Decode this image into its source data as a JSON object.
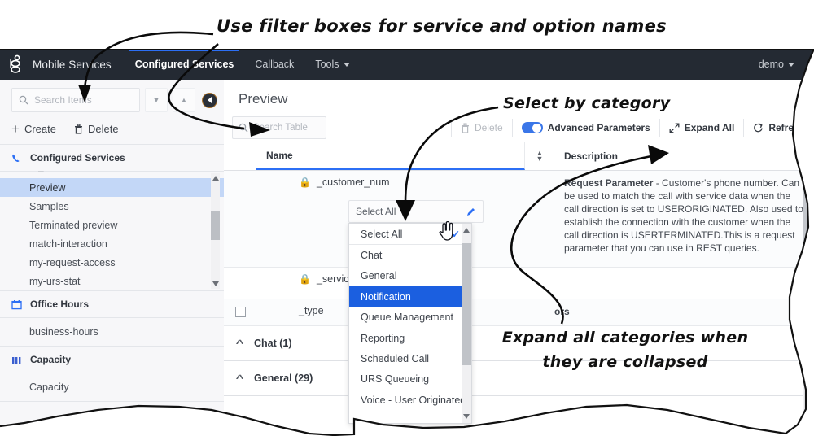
{
  "topnav": {
    "logo": "genesys-logo-icon",
    "brand": "Mobile Services",
    "items": [
      {
        "label": "Configured Services",
        "active": true
      },
      {
        "label": "Callback",
        "active": false
      },
      {
        "label": "Tools",
        "active": false,
        "caret": true
      }
    ],
    "user": "demo"
  },
  "sidebar": {
    "search": {
      "placeholder": "Search Items",
      "icon": "search-icon"
    },
    "sort_desc_icon": "chevron-down-icon",
    "sort_asc_icon": "chevron-up-icon",
    "collapse_icon": "collapse-left-icon",
    "actions": [
      {
        "label": "Create",
        "icon": "plus-icon"
      },
      {
        "label": "Delete",
        "icon": "trash-icon"
      }
    ],
    "groups": [
      {
        "title": "Configured Services",
        "icon": "phone-icon",
        "items": [
          {
            "label": "Preview",
            "selected": true
          },
          {
            "label": "Samples",
            "selected": false
          },
          {
            "label": "Terminated preview",
            "selected": false
          },
          {
            "label": "match-interaction",
            "selected": false
          },
          {
            "label": "my-request-access",
            "selected": false
          },
          {
            "label": "my-urs-stat",
            "selected": false
          }
        ]
      },
      {
        "title": "Office Hours",
        "icon": "calendar-icon",
        "items": [
          {
            "label": "business-hours",
            "selected": false
          }
        ]
      },
      {
        "title": "Capacity",
        "icon": "bars-icon",
        "items": [
          {
            "label": "Capacity",
            "selected": false
          }
        ]
      }
    ]
  },
  "main": {
    "title": "Preview",
    "filter": {
      "placeholder": "Search Table",
      "icon": "search-icon"
    },
    "toolbar": {
      "delete_label": "Delete",
      "delete_icon": "trash-icon",
      "advanced_label": "Advanced Parameters",
      "advanced_on": true,
      "expand_label": "Expand All",
      "expand_icon": "expand-arrows-icon",
      "refresh_label": "Refresh",
      "refresh_icon": "refresh-icon"
    },
    "table": {
      "columns": [
        "Name",
        "Description"
      ],
      "sort_icon": "sort-updown-icon",
      "rows": [
        {
          "name": "_customer_num",
          "locked": true,
          "description": "Request Parameter - Customer's phone number. Can be used to match the call with service data when the call direction is set to USERORIGINATED. Also used to establish the connection with the customer when the call direction is USERTERMINATED.This is a request parameter that you can use in REST queries."
        },
        {
          "name": "_service",
          "locked": true,
          "description": ""
        },
        {
          "name": "_type",
          "locked": false,
          "description": "ors"
        }
      ],
      "categories": [
        {
          "label": "Chat (1)",
          "expanded": true
        },
        {
          "label": "General (29)",
          "expanded": true
        }
      ]
    }
  },
  "dropdown": {
    "trigger_label": "Select All",
    "trigger_icon": "pencil-icon",
    "options": [
      {
        "label": "Select All",
        "checked": true,
        "highlighted": false
      },
      {
        "label": "Chat",
        "checked": false,
        "highlighted": false
      },
      {
        "label": "General",
        "checked": false,
        "highlighted": false
      },
      {
        "label": "Notification",
        "checked": false,
        "highlighted": true
      },
      {
        "label": "Queue Management",
        "checked": false,
        "highlighted": false
      },
      {
        "label": "Reporting",
        "checked": false,
        "highlighted": false
      },
      {
        "label": "Scheduled Call",
        "checked": false,
        "highlighted": false
      },
      {
        "label": "URS Queueing",
        "checked": false,
        "highlighted": false
      },
      {
        "label": "Voice - User Originated",
        "checked": false,
        "highlighted": false
      }
    ],
    "cursor": "hand-pointer-cursor"
  },
  "annotations": [
    {
      "id": "anno-1",
      "text": "Use filter boxes for service and option names"
    },
    {
      "id": "anno-2",
      "text": "Select by category"
    },
    {
      "id": "anno-3",
      "text": "Expand all categories when\nthey are collapsed"
    }
  ]
}
